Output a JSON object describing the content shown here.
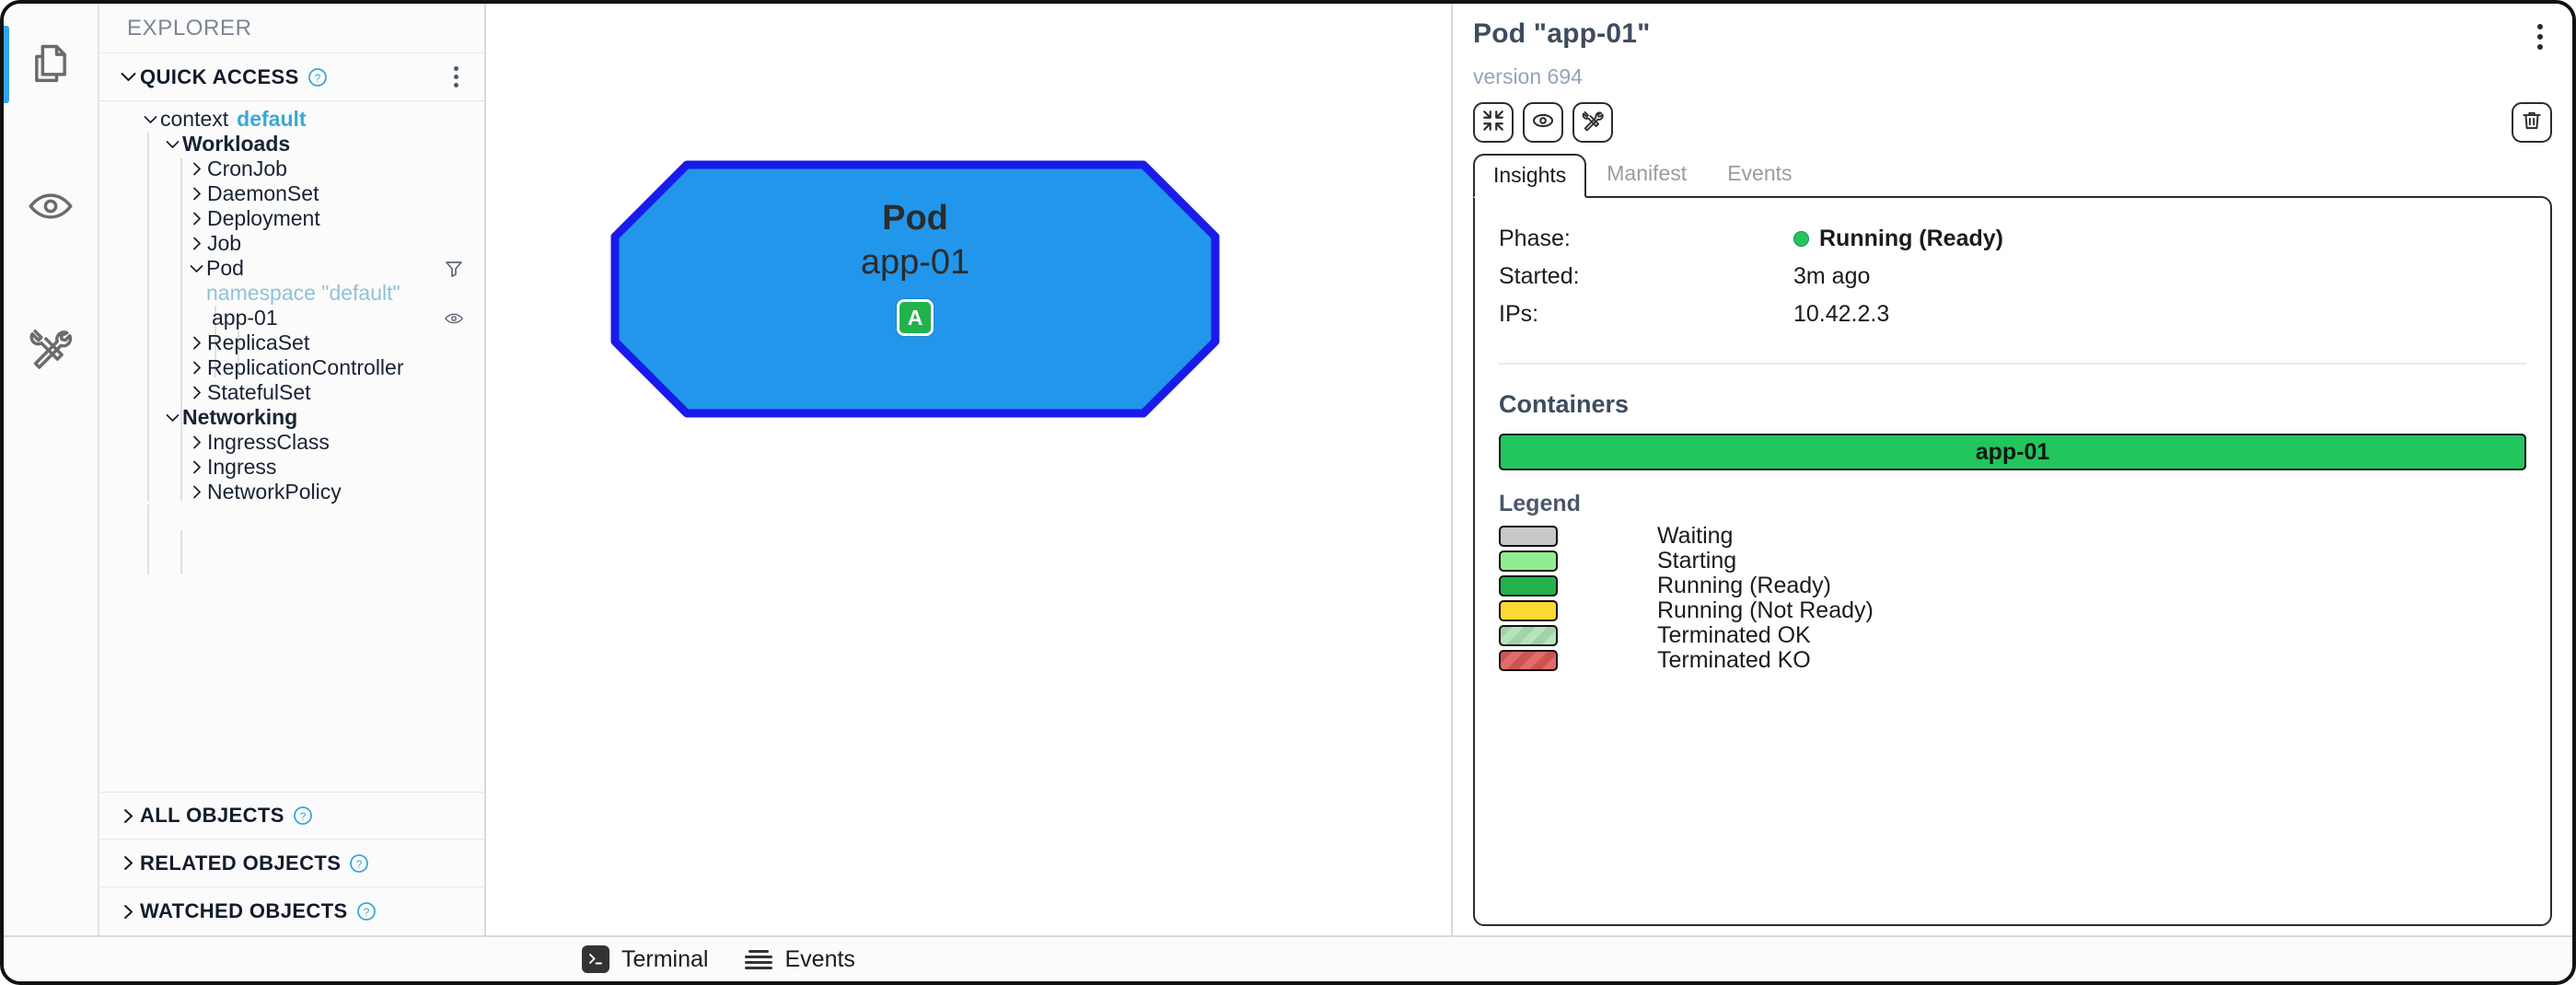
{
  "colors": {
    "accent_blue": "#35a3e8",
    "tree_accent": "#3ba8d4",
    "namespace_blue": "#8fc3d8",
    "node_fill": "#2196eb",
    "node_stroke": "#1a1aea",
    "badge_green": "#22b24c",
    "running_green": "#22c55e",
    "title_slate": "#3e4c5e"
  },
  "rail": {
    "items": [
      {
        "icon": "documents-icon",
        "active": true
      },
      {
        "icon": "eye-icon",
        "active": false
      },
      {
        "icon": "tools-icon",
        "active": false
      }
    ]
  },
  "sidebar": {
    "title": "EXPLORER",
    "quick_access": {
      "label": "QUICK ACCESS",
      "help": "?",
      "expanded": true
    },
    "tree": [
      {
        "label": "context",
        "accent": "default",
        "twisty": "down",
        "depth": 0,
        "bold": false
      },
      {
        "label": "Workloads",
        "twisty": "down",
        "depth": 1,
        "bold": true
      },
      {
        "label": "CronJob",
        "twisty": "right",
        "depth": 2,
        "bold": false
      },
      {
        "label": "DaemonSet",
        "twisty": "right",
        "depth": 2,
        "bold": false
      },
      {
        "label": "Deployment",
        "twisty": "right",
        "depth": 2,
        "bold": false
      },
      {
        "label": "Job",
        "twisty": "right",
        "depth": 2,
        "bold": false
      },
      {
        "label": "Pod",
        "twisty": "down",
        "depth": 2,
        "bold": false,
        "right_icon": "filter-icon"
      },
      {
        "label": "namespace \"default\"",
        "twisty": "none",
        "depth": 3,
        "bold": false,
        "muted_blue": true
      },
      {
        "label": "app-01",
        "twisty": "none",
        "depth": 4,
        "bold": false,
        "right_icon": "eye-icon"
      },
      {
        "label": "ReplicaSet",
        "twisty": "right",
        "depth": 2,
        "bold": false
      },
      {
        "label": "ReplicationController",
        "twisty": "right",
        "depth": 2,
        "bold": false
      },
      {
        "label": "StatefulSet",
        "twisty": "right",
        "depth": 2,
        "bold": false
      },
      {
        "label": "Networking",
        "twisty": "down",
        "depth": 1,
        "bold": true
      },
      {
        "label": "IngressClass",
        "twisty": "right",
        "depth": 2,
        "bold": false
      },
      {
        "label": "Ingress",
        "twisty": "right",
        "depth": 2,
        "bold": false
      },
      {
        "label": "NetworkPolicy",
        "twisty": "right",
        "depth": 2,
        "bold": false
      }
    ],
    "sections": [
      {
        "label": "ALL OBJECTS",
        "help": "?",
        "expanded": false
      },
      {
        "label": "RELATED OBJECTS",
        "help": "?",
        "expanded": false
      },
      {
        "label": "WATCHED OBJECTS",
        "help": "?",
        "expanded": false
      }
    ]
  },
  "canvas": {
    "node": {
      "kind": "Pod",
      "name": "app-01",
      "badge": "A",
      "shape": "octagon"
    }
  },
  "detail": {
    "title": "Pod \"app-01\"",
    "version": "version 694",
    "toolbar": [
      {
        "icon": "collapse-icon"
      },
      {
        "icon": "watch-eye-icon"
      },
      {
        "icon": "tools-icon"
      }
    ],
    "delete_icon": "trash-icon",
    "menu_icon": "kebab-menu-icon",
    "tabs": [
      {
        "label": "Insights",
        "active": true
      },
      {
        "label": "Manifest",
        "active": false
      },
      {
        "label": "Events",
        "active": false
      }
    ],
    "insights": {
      "fields": [
        {
          "key": "Phase:",
          "value": "Running (Ready)",
          "dot": true,
          "bold": true
        },
        {
          "key": "Started:",
          "value": "3m ago",
          "dot": false,
          "bold": false
        },
        {
          "key": "IPs:",
          "value": "10.42.2.3",
          "dot": false,
          "bold": false
        }
      ],
      "containers_title": "Containers",
      "containers": [
        {
          "name": "app-01",
          "color": "#22c55e"
        }
      ],
      "legend_title": "Legend",
      "legend": [
        {
          "label": "Waiting",
          "color": "#c8c8c8",
          "striped": false
        },
        {
          "label": "Starting",
          "color": "#90ee90",
          "striped": false
        },
        {
          "label": "Running (Ready)",
          "color": "#22b24c",
          "striped": false
        },
        {
          "label": "Running (Not Ready)",
          "color": "#fbd834",
          "striped": false
        },
        {
          "label": "Terminated OK",
          "color": "#9fd5a6",
          "striped": true
        },
        {
          "label": "Terminated KO",
          "color": "#d9605e",
          "striped": true
        }
      ]
    }
  },
  "bottom_bar": {
    "items": [
      {
        "label": "Terminal",
        "icon": "terminal-icon"
      },
      {
        "label": "Events",
        "icon": "stack-icon"
      }
    ]
  }
}
